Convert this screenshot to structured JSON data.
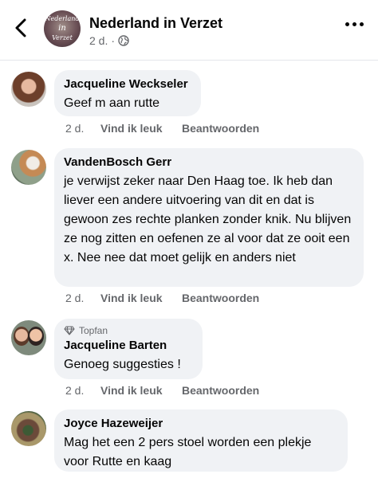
{
  "header": {
    "page_name": "Nederland in Verzet",
    "time": "2 d.",
    "separator": "·",
    "avatar_text": [
      "Nederland",
      "in",
      "Verzet"
    ]
  },
  "comments": [
    {
      "author": "Jacqueline Weckseler",
      "text": "Geef m aan rutte",
      "time": "2 d.",
      "like": "Vind ik leuk",
      "reply": "Beantwoorden"
    },
    {
      "author": "VandenBosch Gerr",
      "text": "je verwijst zeker naar Den Haag toe. Ik heb dan liever een andere uitvoering van dit en dat is gewoon zes rechte planken zonder knik. Nu blijven ze nog zitten en oefenen ze al voor dat ze ooit een x. Nee nee dat moet gelijk en anders niet",
      "time": "2 d.",
      "like": "Vind ik leuk",
      "reply": "Beantwoorden"
    },
    {
      "badge": "Topfan",
      "author": "Jacqueline Barten",
      "text": "Genoeg suggesties !",
      "time": "2 d.",
      "like": "Vind ik leuk",
      "reply": "Beantwoorden"
    },
    {
      "author": "Joyce Hazeweijer",
      "text": "Mag het een 2 pers stoel worden een plekje voor Rutte en kaag"
    }
  ]
}
